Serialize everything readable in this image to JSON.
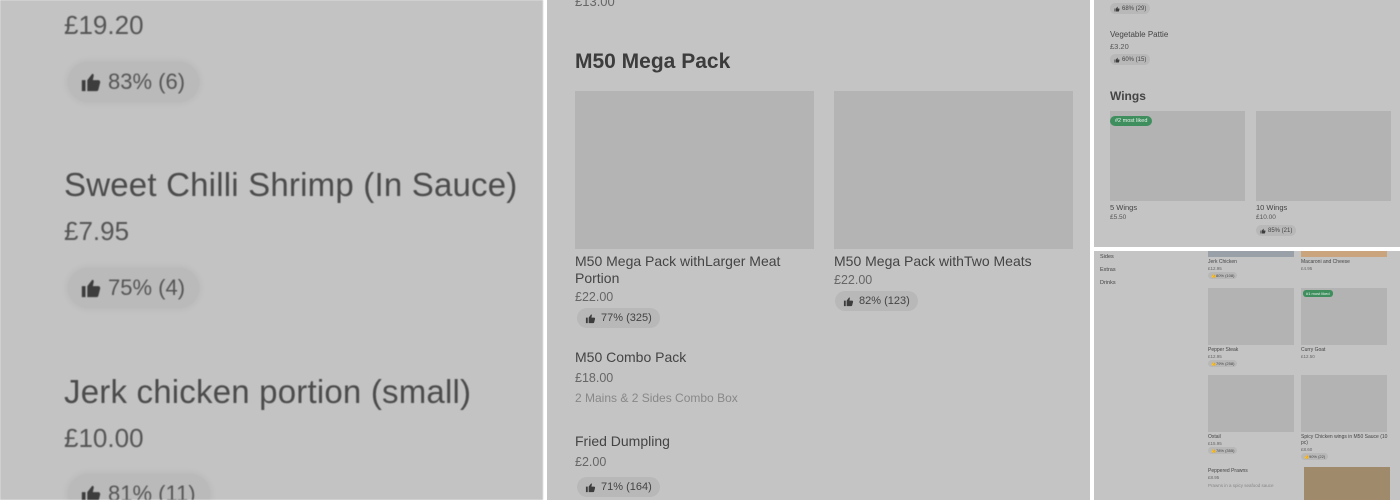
{
  "panel1": {
    "top_price": "£19.20",
    "top_rating": "83% (6)",
    "items": [
      {
        "name": "Sweet Chilli Shrimp (In Sauce)",
        "price": "£7.95",
        "rating": "75% (4)"
      },
      {
        "name": "Jerk chicken portion (small)",
        "price": "£10.00",
        "rating": "81% (11)"
      }
    ]
  },
  "panel2": {
    "top_price": "£13.00",
    "section_title": "M50 Mega Pack",
    "cards": [
      {
        "name_line1": "M50 Mega Pack withLarger Meat",
        "name_line2": "Portion",
        "price": "£22.00",
        "rating": "77% (325)"
      },
      {
        "name_line1": "M50 Mega Pack withTwo Meats",
        "name_line2": "",
        "price": "£22.00",
        "rating": "82% (123)"
      }
    ],
    "list": [
      {
        "name": "M50 Combo Pack",
        "price": "£18.00",
        "description": "2 Mains & 2 Sides Combo Box"
      },
      {
        "name": "Fried Dumpling",
        "price": "£2.00",
        "rating": "71% (164)"
      }
    ]
  },
  "panel3": {
    "top_rating": "68% (29)",
    "item_name": "Vegetable Pattie",
    "item_price": "£3.20",
    "item_rating": "60% (15)",
    "section_title": "Wings",
    "badge": "#2 most liked",
    "cards": [
      {
        "name": "5 Wings",
        "price": "£5.50",
        "rating": ""
      },
      {
        "name": "10 Wings",
        "price": "£10.00",
        "rating": "85% (21)"
      }
    ]
  },
  "panel4": {
    "sidebar": [
      "Sides",
      "Extras",
      "Drinks"
    ],
    "badge": "#1 most liked",
    "grid": [
      {
        "name": "Jerk Chicken",
        "price": "£12.95",
        "rating": "80% (108)"
      },
      {
        "name": "Macaroni and Cheese",
        "price": "£4.95",
        "rating": ""
      },
      {
        "name": "Pepper Steak",
        "price": "£12.95",
        "rating": "79% (258)"
      },
      {
        "name": "Curry Goat",
        "price": "£12.50",
        "rating": ""
      },
      {
        "name": "Oxtail",
        "price": "£15.95",
        "rating": "78% (355)"
      },
      {
        "name": "Spicy Chicken wings in M50 Sauce (10 pc)",
        "price": "£8.60",
        "rating": "90% (22)"
      },
      {
        "name": "Peppered Prawns",
        "price": "£8.95",
        "rating": "",
        "description": "Prawns in a spicy seafood sauce"
      }
    ]
  }
}
